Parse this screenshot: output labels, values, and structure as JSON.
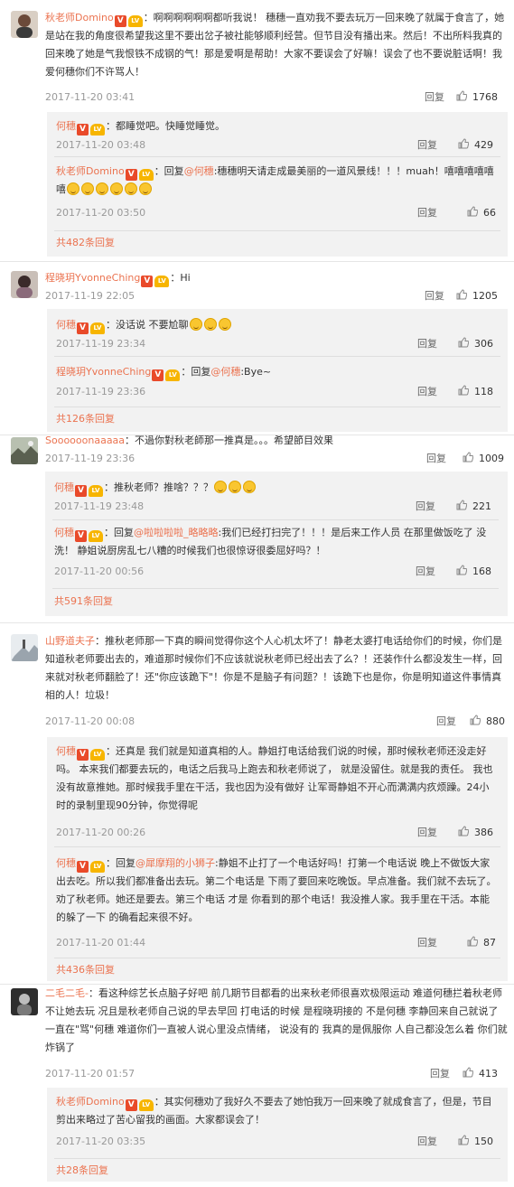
{
  "threads": [
    {
      "user": "秋老师Domino",
      "avatar_color": "#7a5a4a",
      "text": "：啊啊啊啊啊啊都听我说！ 穗穗一直劝我不要去玩万一回来晚了就属于食言了，她是站在我的角度很希望我这里不要出岔子被社能够顺利经营。但节目没有播出来。然后！不出所料我真的回来晚了她是气我恨铁不成钢的气！那是爱啊是帮助！大家不要误会了好嘛！误会了也不要说脏话啊！我爱何穗你们不许骂人！",
      "time": "2017-11-20 03:41",
      "reply_label": "回复",
      "likes": "1768",
      "subs": [
        {
          "user": "何穗",
          "text_parts": [
            "：都睡觉吧。快睡觉睡觉。"
          ],
          "emojis": 0,
          "time": "2017-11-20 03:48",
          "reply_label": "回复",
          "likes": "429"
        },
        {
          "user": "秋老师Domino",
          "text_parts": [
            "：回复",
            "@何穗",
            ":穗穗明天请走成最美丽的一道风景线！！！muah！嘻嘻嘻嘻嘻嘻"
          ],
          "emojis": 6,
          "time": "2017-11-20 03:50",
          "reply_label": "回复",
          "likes": "66"
        }
      ],
      "more": "共482条回复"
    },
    {
      "user": "程晓玥YvonneChing",
      "avatar_color": "#5a4a52",
      "text": "：Hi",
      "time": "2017-11-19 22:05",
      "reply_label": "回复",
      "likes": "1205",
      "subs": [
        {
          "user": "何穗",
          "text_parts": [
            "：没话说 不要尬聊"
          ],
          "emojis": 3,
          "time": "2017-11-19 23:34",
          "reply_label": "回复",
          "likes": "306"
        },
        {
          "user": "程晓玥YvonneChing",
          "text_parts": [
            "：回复",
            "@何穗",
            ":Bye~"
          ],
          "emojis": 0,
          "time": "2017-11-19 23:36",
          "reply_label": "回复",
          "likes": "118"
        }
      ],
      "more": "共126条回复"
    },
    {
      "user": "Soooooonaaaaa",
      "avatar_color": "#6a7060",
      "text": "：不過你對秋老師那一推真是。。。希望節目效果",
      "time": "2017-11-19 23:36",
      "reply_label": "回复",
      "likes": "1009",
      "subs": [
        {
          "user": "何穗",
          "text_parts": [
            "：推秋老师？推啥？？？"
          ],
          "emojis": 3,
          "time": "2017-11-19 23:48",
          "reply_label": "回复",
          "likes": "221"
        },
        {
          "user": "何穗",
          "text_parts": [
            "：回复",
            "@啦啦啦啦_略略略",
            ":我们已经打扫完了！！！是后来工作人员 在那里做饭吃了 没洗！ 静姐说厨房乱七八糟的时候我们也很惊讶很委屈好吗？！"
          ],
          "emojis": 0,
          "time": "2017-11-20 00:56",
          "reply_label": "回复",
          "likes": "168"
        }
      ],
      "more": "共591条回复"
    },
    {
      "user": "山野道夫子",
      "avatar_color": "#8a9aa8",
      "text": "：推秋老师那一下真的瞬间觉得你这个人心机太坏了！静老太婆打电话给你们的时候，你们是知道秋老师要出去的，难道那时候你们不应该就说秋老师已经出去了么？！还装作什么都没发生一样，回来就对秋老师翻脸了！还\"你应该跪下\"！你是不是脑子有问题？！该跪下也是你，你是明知道这件事情真相的人！垃圾！",
      "time": "2017-11-20 00:08",
      "reply_label": "回复",
      "likes": "880",
      "subs": [
        {
          "user": "何穗",
          "text_parts": [
            "：还真是 我们就是知道真相的人。静姐打电话给我们说的时候，那时候秋老师还没走好吗。 本来我们都要去玩的，电话之后我马上跑去和秋老师说了， 就是没留住。就是我的责任。 我也没有故意推她。那时候我手里在干活，我也因为没有做好 让军哥静姐不开心而满满内疚烦躁。24小时的录制里现90分钟，你觉得呢"
          ],
          "emojis": 0,
          "time": "2017-11-20 00:26",
          "reply_label": "回复",
          "likes": "386"
        },
        {
          "user": "何穗",
          "text_parts": [
            "：回复",
            "@犀摩翔的小狮子",
            ":静姐不止打了一个电话好吗！打第一个电话说 晚上不做饭大家出去吃。所以我们都准备出去玩。第二个电话是 下雨了要回来吃晚饭。早点准备。我们就不去玩了。劝了秋老师。她还是要去。第三个电话 才是 你看到的那个电话！我没推人家。我手里在干活。本能的躲了一下 的确看起来很不好。"
          ],
          "emojis": 0,
          "time": "2017-11-20 01:44",
          "reply_label": "回复",
          "likes": "87"
        }
      ],
      "more": "共436条回复"
    },
    {
      "user": "二毛二毛-",
      "avatar_color": "#555555",
      "text": "：看这种综艺长点脑子好吧 前几期节目都看的出来秋老师很喜欢极限运动 难道何穗拦着秋老师不让她去玩 况且是秋老师自己说的早去早回 打电话的时候 是程晓玥接的 不是何穗 李静回来自己就说了一直在\"骂\"何穗 难道你们一直被人说心里没点情绪， 说没有的 我真的是佩服你 人自己都没怎么着 你们就炸锅了",
      "time": "2017-11-20 01:57",
      "reply_label": "回复",
      "likes": "413",
      "subs": [
        {
          "user": "秋老师Domino",
          "text_parts": [
            "：其实何穗劝了我好久不要去了她怕我万一回来晚了就成食言了，但是，节目剪出来略过了苦心留我的画面。大家都误会了！"
          ],
          "emojis": 0,
          "time": "2017-11-20 03:35",
          "reply_label": "回复",
          "likes": "150"
        }
      ],
      "more": "共28条回复"
    }
  ],
  "badges": {
    "v": "V",
    "lv": "LV"
  },
  "colors": {
    "accent": "#eb7350",
    "meta": "#999999",
    "sub_bg": "#f2f2f2"
  }
}
